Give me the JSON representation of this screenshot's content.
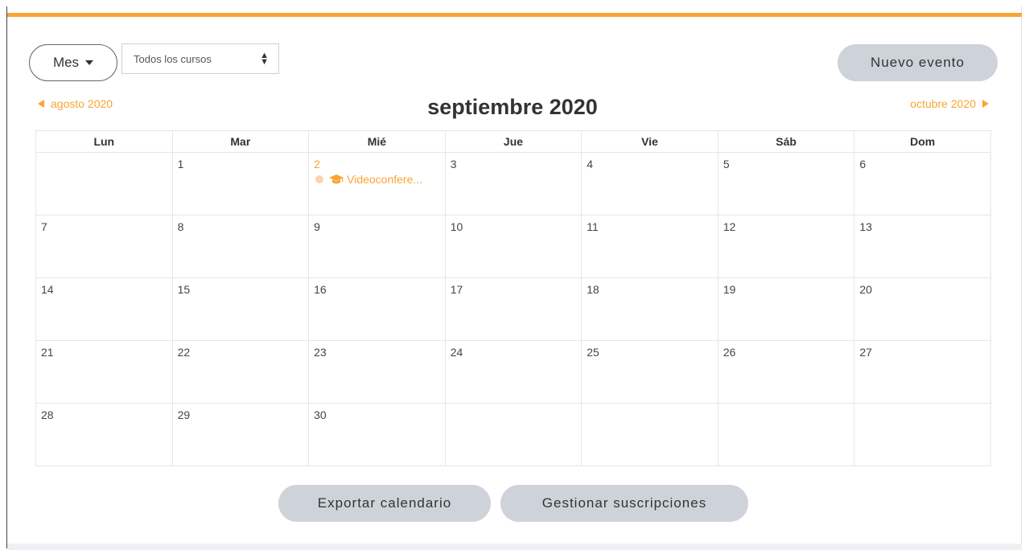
{
  "toolbar": {
    "view_label": "Mes",
    "course_select_value": "Todos los cursos",
    "new_event_label": "Nuevo evento"
  },
  "nav": {
    "prev_label": "agosto 2020",
    "title": "septiembre 2020",
    "next_label": "octubre 2020"
  },
  "calendar": {
    "weekdays": [
      "Lun",
      "Mar",
      "Mié",
      "Jue",
      "Vie",
      "Sáb",
      "Dom"
    ],
    "weeks": [
      [
        "",
        "1",
        "2",
        "3",
        "4",
        "5",
        "6"
      ],
      [
        "7",
        "8",
        "9",
        "10",
        "11",
        "12",
        "13"
      ],
      [
        "14",
        "15",
        "16",
        "17",
        "18",
        "19",
        "20"
      ],
      [
        "21",
        "22",
        "23",
        "24",
        "25",
        "26",
        "27"
      ],
      [
        "28",
        "29",
        "30",
        "",
        "",
        "",
        ""
      ]
    ],
    "event": {
      "day": "2",
      "label": "Videoconfere...",
      "icon": "graduation-cap-icon"
    }
  },
  "footer": {
    "export_label": "Exportar calendario",
    "subscriptions_label": "Gestionar suscripciones"
  },
  "colors": {
    "accent": "#f9a533",
    "button_gray": "#ced3d9"
  }
}
